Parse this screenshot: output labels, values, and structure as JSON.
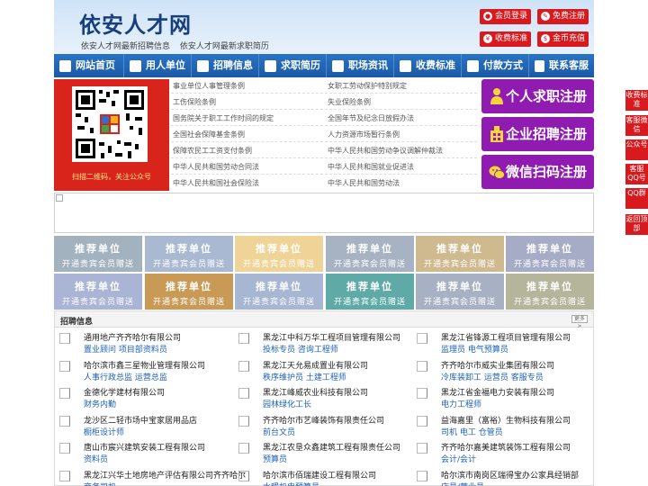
{
  "header": {
    "title": "依安人才网",
    "links": [
      "依安人才网最新招聘信息",
      "依安人才网最新求职简历"
    ],
    "buttons": [
      {
        "label": "会员登录",
        "icon": "user-icon"
      },
      {
        "label": "免费注册",
        "icon": "pen-icon"
      },
      {
        "label": "收费标准",
        "icon": "yen-icon"
      },
      {
        "label": "金币充值",
        "icon": "coin-icon"
      }
    ]
  },
  "nav": [
    {
      "label": "网站首页",
      "icon": "home-icon"
    },
    {
      "label": "用人单位",
      "icon": "building-icon"
    },
    {
      "label": "招聘信息",
      "icon": "megaphone-icon"
    },
    {
      "label": "求职简历",
      "icon": "resume-icon"
    },
    {
      "label": "职场资讯",
      "icon": "news-icon"
    },
    {
      "label": "收费标准",
      "icon": "yen-icon"
    },
    {
      "label": "付款方式",
      "icon": "card-icon"
    },
    {
      "label": "联系客服",
      "icon": "phone-icon"
    }
  ],
  "qr": {
    "caption": "扫描二维码，关注公众号"
  },
  "laws_left": [
    "事业单位人事管理条例",
    "工伤保险条例",
    "国务院关于职工工作时间的规定",
    "全国社会保障基金条例",
    "保障农民工工资支付条例",
    "中华人民共和国劳动合同法",
    "中华人民共和国社会保险法"
  ],
  "laws_right": [
    "女职工劳动保护特别规定",
    "失业保险条例",
    "全国年节及纪念日放假办法",
    "人力资源市场暂行条例",
    "中华人民共和国劳动争议调解仲裁法",
    "中华人民共和国就业促进法",
    "中华人民共和国劳动法"
  ],
  "register": [
    {
      "label": "个人求职注册",
      "icon": "person-icon"
    },
    {
      "label": "企业招聘注册",
      "icon": "company-icon"
    },
    {
      "label": "微信扫码注册",
      "icon": "wechat-icon"
    }
  ],
  "recommend": {
    "title": "推荐单位",
    "subtitle": "开通贵宾会员赠送",
    "colors": [
      "#a3b2bf",
      "#a9b9d2",
      "#f0d497",
      "#a7b3c2",
      "#cfb98f",
      "#a7acc6",
      "#aab4d4",
      "#c89a56",
      "#a7b6d3",
      "#5fa9a6",
      "#a8b1c3",
      "#b5b59b",
      "#a4b6d5",
      "#a9aec7"
    ]
  },
  "jobs": {
    "title": "招聘信息",
    "more": "更多>",
    "items": [
      {
        "company": "通用地产齐齐哈尔有限公司",
        "positions": "置业顾问 项目部资料员"
      },
      {
        "company": "黑龙江中科万华工程项目管理有限公司",
        "positions": "投标专员 咨询工程师"
      },
      {
        "company": "黑龙江省锋源工程项目管理有限公司",
        "positions": "监理员 电气预算员"
      },
      {
        "company": "哈尔滨市鑫三星物业管理有限公司",
        "positions": "人事行政总监 运营总监"
      },
      {
        "company": "黑龙江天允易成置业有限公司",
        "positions": "秩序维护员 土建工程师"
      },
      {
        "company": "齐齐哈尔市威实业集团有限公司",
        "positions": "冷库装卸工 运营员 客服专员"
      },
      {
        "company": "金德化学建材有限公司",
        "positions": "财务内勤"
      },
      {
        "company": "黑龙江峰威农业科技有限公司",
        "positions": "园林绿化工长"
      },
      {
        "company": "黑龙江省金福电力安装有限公司",
        "positions": "电力工程师"
      },
      {
        "company": "龙沙区二轻市场中宝家居用品店",
        "positions": "橱柜设计师"
      },
      {
        "company": "齐齐哈尔市艺峰装饰有限责任公司",
        "positions": "前台文员"
      },
      {
        "company": "益海嘉里（富裕）生物科技有限公司",
        "positions": "司机 电工 仓管员"
      },
      {
        "company": "唐山市宸兴建筑安装工程有限公司",
        "positions": "资料员"
      },
      {
        "company": "黑龙江农垦众鑫建筑工程有限责任公司",
        "positions": "预算员"
      },
      {
        "company": "齐齐哈尔嘉美建筑装饰工程有限公司",
        "positions": "会计/会计"
      },
      {
        "company": "黑龙江兴华土地房地产评估有限公司齐齐哈尔",
        "positions": "商务司机"
      },
      {
        "company": "哈尔滨市佰瑞建设工程有限公司",
        "positions": "水暖机电预算员"
      },
      {
        "company": "哈尔滨市南岗区瑞得宝办公家具经销部",
        "positions": "店员/营业员"
      }
    ]
  },
  "side": [
    "收费标准",
    "客服微信",
    "公众号",
    "客服QQ号",
    "QQ群",
    "返回顶部"
  ]
}
